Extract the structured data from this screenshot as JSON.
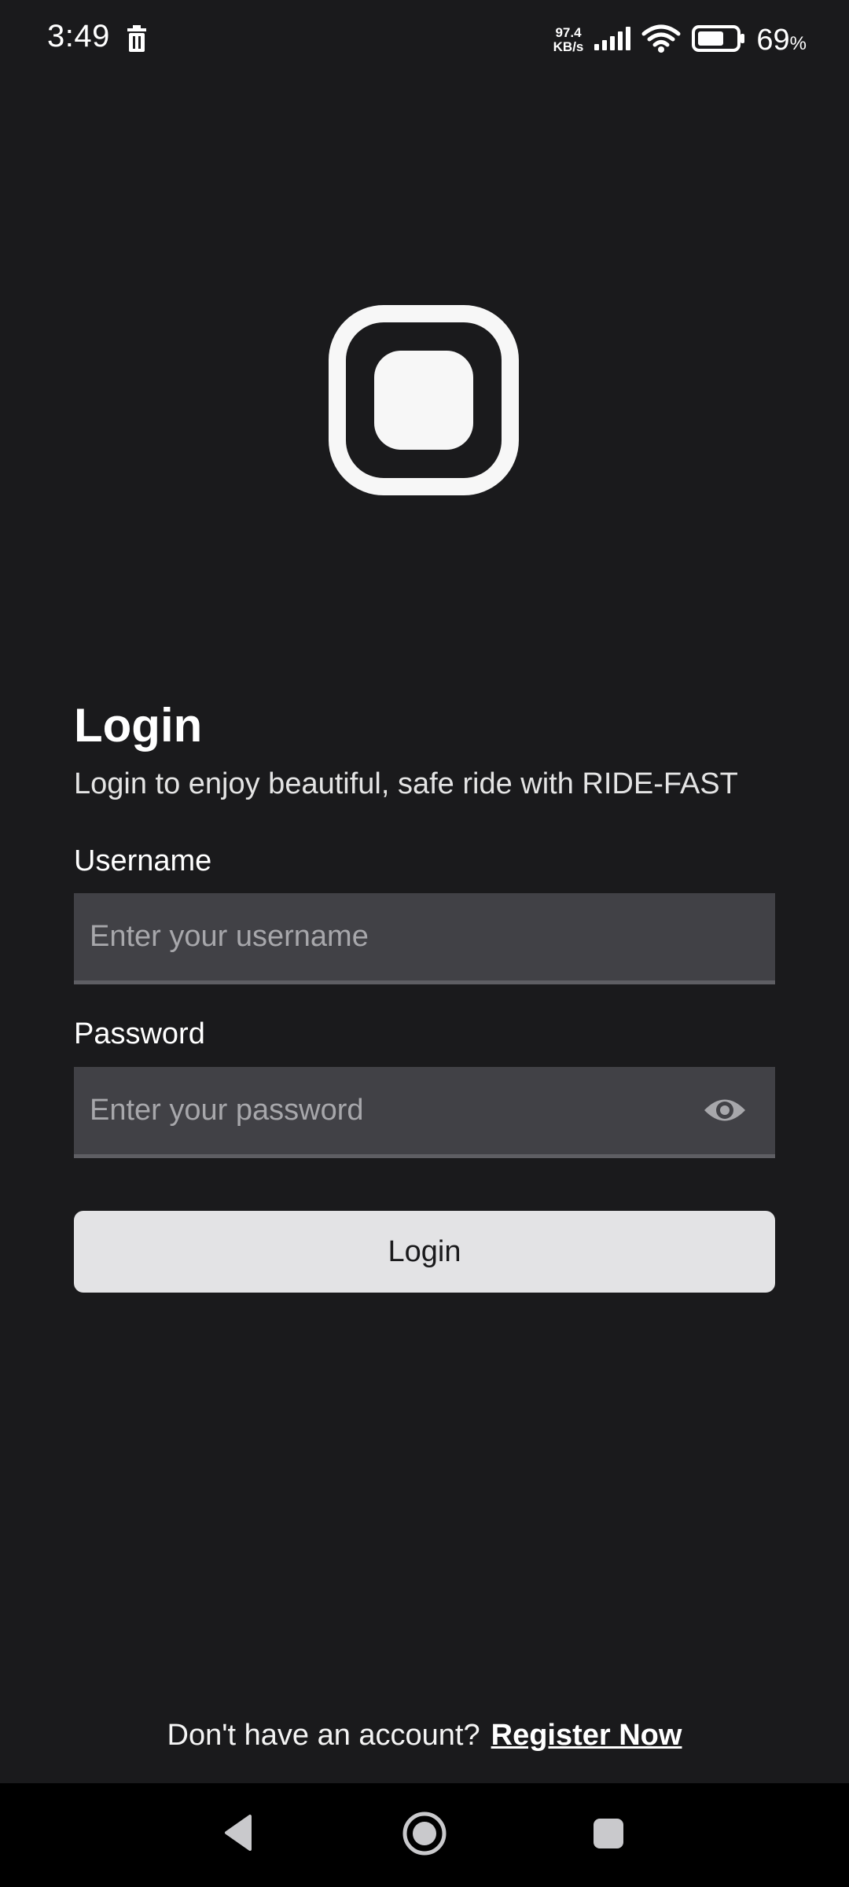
{
  "status_bar": {
    "time": "3:49",
    "net_speed_value": "97.4",
    "net_speed_unit": "KB/s",
    "battery_percent": "69",
    "battery_unit": "%"
  },
  "form": {
    "title": "Login",
    "subtitle": "Login to enjoy beautiful, safe ride with RIDE-FAST",
    "username_label": "Username",
    "username_placeholder": "Enter your username",
    "username_value": "",
    "password_label": "Password",
    "password_placeholder": "Enter your password",
    "password_value": "",
    "login_button": "Login"
  },
  "footer": {
    "prompt": "Don't have an account?",
    "register_link": "Register Now"
  },
  "icons": {
    "logo": "app-logo-icon",
    "password_toggle": "eye-icon",
    "status_notification": "trash-icon",
    "nav_back": "back-triangle-icon",
    "nav_home": "home-circle-icon",
    "nav_recent": "recent-square-icon"
  },
  "colors": {
    "background": "#1a1a1c",
    "input_background": "#414146",
    "button_background": "#e3e3e5",
    "accent_text": "#ffffff"
  }
}
